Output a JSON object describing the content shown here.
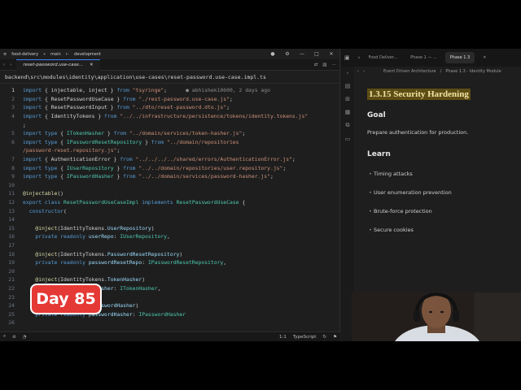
{
  "titlebar": {
    "project": "food-delivery",
    "branch": "main",
    "worktree": "development"
  },
  "editor": {
    "tab": "reset-password.use-case...",
    "path": "backend\\src\\modules\\identity\\application\\use-cases\\reset-password.use-case.impl.ts",
    "lines": [
      {
        "n": "1",
        "t": [
          [
            "kw",
            "import"
          ],
          [
            "lt",
            " { injectable, inject } "
          ],
          [
            "kw",
            "from"
          ],
          [
            "st",
            " \"tsyringe\""
          ],
          [
            "lt",
            ";      "
          ],
          [
            "blame",
            "● abhishek10600, 2 days ago"
          ]
        ]
      },
      {
        "n": "2",
        "t": [
          [
            "kw",
            "import"
          ],
          [
            "lt",
            " { ResetPasswordUseCase } "
          ],
          [
            "kw",
            "from"
          ],
          [
            "st",
            " \"./rest-password.use-case.js\""
          ],
          [
            "lt",
            ";"
          ]
        ]
      },
      {
        "n": "3",
        "t": [
          [
            "kw",
            "import"
          ],
          [
            "lt",
            " { ResetPasswordInput } "
          ],
          [
            "kw",
            "from"
          ],
          [
            "st",
            " \"../dto/reset-password.dto.js\""
          ],
          [
            "lt",
            ";"
          ]
        ]
      },
      {
        "n": "4",
        "t": [
          [
            "kw",
            "import"
          ],
          [
            "lt",
            " { IdentityTokens } "
          ],
          [
            "kw",
            "from"
          ],
          [
            "st",
            " \"../../infrastructure/persistence/tokens/identity.tokens.js\""
          ]
        ]
      },
      {
        "n": "",
        "t": [
          [
            "lt",
            ";"
          ]
        ]
      },
      {
        "n": "5",
        "t": [
          [
            "kw",
            "import type"
          ],
          [
            "lt",
            " { "
          ],
          [
            "ty",
            "ITokenHasher"
          ],
          [
            "lt",
            " } "
          ],
          [
            "kw",
            "from"
          ],
          [
            "st",
            " \"../domain/services/token-hasher.js\""
          ],
          [
            "lt",
            ";"
          ]
        ]
      },
      {
        "n": "6",
        "t": [
          [
            "kw",
            "import type"
          ],
          [
            "lt",
            " { "
          ],
          [
            "ty",
            "IPasswordResetRepository"
          ],
          [
            "lt",
            " } "
          ],
          [
            "kw",
            "from"
          ],
          [
            "st",
            " \"../domain/repositories"
          ]
        ]
      },
      {
        "n": "",
        "t": [
          [
            "st",
            "/password-reset.repository.js\""
          ],
          [
            "lt",
            ";"
          ]
        ]
      },
      {
        "n": "7",
        "t": [
          [
            "kw",
            "import"
          ],
          [
            "lt",
            " { AuthenticationError } "
          ],
          [
            "kw",
            "from"
          ],
          [
            "st",
            " \"../../../../shared/errors/AuthenticationError.js\""
          ],
          [
            "lt",
            ";"
          ]
        ]
      },
      {
        "n": "8",
        "t": [
          [
            "kw",
            "import type"
          ],
          [
            "lt",
            " { "
          ],
          [
            "ty",
            "IUserRepository"
          ],
          [
            "lt",
            " } "
          ],
          [
            "kw",
            "from"
          ],
          [
            "st",
            " \"../../domain/repositories/user.repository.js\""
          ],
          [
            "lt",
            ";"
          ]
        ]
      },
      {
        "n": "9",
        "t": [
          [
            "kw",
            "import type"
          ],
          [
            "lt",
            " { "
          ],
          [
            "ty",
            "IPasswordHasher"
          ],
          [
            "lt",
            " } "
          ],
          [
            "kw",
            "from"
          ],
          [
            "st",
            " \"../../domain/services/password-hasher.js\""
          ],
          [
            "lt",
            ";"
          ]
        ]
      },
      {
        "n": "10",
        "t": [
          [
            "lt",
            ""
          ]
        ]
      },
      {
        "n": "11",
        "t": [
          [
            "fn",
            "@injectable"
          ],
          [
            "lt",
            "()"
          ]
        ]
      },
      {
        "n": "12",
        "t": [
          [
            "kw",
            "export class"
          ],
          [
            "lt",
            " "
          ],
          [
            "ty",
            "ResetPasswordUseCaseImpl"
          ],
          [
            "lt",
            " "
          ],
          [
            "kw",
            "implements"
          ],
          [
            "lt",
            " "
          ],
          [
            "ty",
            "ResetPasswordUseCase"
          ],
          [
            "lt",
            " {"
          ]
        ]
      },
      {
        "n": "13",
        "t": [
          [
            "lt",
            "  "
          ],
          [
            "kw",
            "constructor"
          ],
          [
            "lt",
            "("
          ]
        ]
      },
      {
        "n": "14",
        "t": [
          [
            "lt",
            ""
          ]
        ]
      },
      {
        "n": "15",
        "t": [
          [
            "lt",
            "    "
          ],
          [
            "fn",
            "@inject"
          ],
          [
            "lt",
            "(IdentityTokens."
          ],
          [
            "vr",
            "UserRepository"
          ],
          [
            "lt",
            ")"
          ]
        ]
      },
      {
        "n": "16",
        "t": [
          [
            "lt",
            "    "
          ],
          [
            "kw",
            "private readonly"
          ],
          [
            "lt",
            " "
          ],
          [
            "vr",
            "userRepo"
          ],
          [
            "lt",
            ": "
          ],
          [
            "ty",
            "IUserRepository"
          ],
          [
            "lt",
            ","
          ]
        ]
      },
      {
        "n": "17",
        "t": [
          [
            "lt",
            ""
          ]
        ]
      },
      {
        "n": "18",
        "t": [
          [
            "lt",
            "    "
          ],
          [
            "fn",
            "@inject"
          ],
          [
            "lt",
            "(IdentityTokens."
          ],
          [
            "vr",
            "PasswordResetRepository"
          ],
          [
            "lt",
            ")"
          ]
        ]
      },
      {
        "n": "19",
        "t": [
          [
            "lt",
            "    "
          ],
          [
            "kw",
            "private readonly"
          ],
          [
            "lt",
            " "
          ],
          [
            "vr",
            "passwordResetRepo"
          ],
          [
            "lt",
            ": "
          ],
          [
            "ty",
            "IPasswordResetRepository"
          ],
          [
            "lt",
            ","
          ]
        ]
      },
      {
        "n": "20",
        "t": [
          [
            "lt",
            ""
          ]
        ]
      },
      {
        "n": "21",
        "t": [
          [
            "lt",
            "    "
          ],
          [
            "fn",
            "@inject"
          ],
          [
            "lt",
            "(IdentityTokens."
          ],
          [
            "vr",
            "TokenHasher"
          ],
          [
            "lt",
            ")"
          ]
        ]
      },
      {
        "n": "22",
        "t": [
          [
            "lt",
            "                  "
          ],
          [
            "vr",
            "tokenHasher"
          ],
          [
            "lt",
            ": "
          ],
          [
            "ty",
            "ITokenHasher"
          ],
          [
            "lt",
            ","
          ]
        ]
      },
      {
        "n": "23",
        "t": [
          [
            "lt",
            ""
          ]
        ]
      },
      {
        "n": "24",
        "t": [
          [
            "lt",
            "                  ens."
          ],
          [
            "vr",
            "PasswordHasher"
          ],
          [
            "lt",
            ")"
          ]
        ]
      },
      {
        "n": "25",
        "t": [
          [
            "lt",
            "    "
          ],
          [
            "kw",
            "private readonly"
          ],
          [
            "lt",
            " "
          ],
          [
            "vr",
            "passwordHasher"
          ],
          [
            "lt",
            ": "
          ],
          [
            "ty",
            "IPasswordHasher"
          ]
        ]
      },
      {
        "n": "26",
        "t": [
          [
            "lt",
            ""
          ]
        ]
      }
    ]
  },
  "status": {
    "position": "1:1",
    "language": "TypeScript"
  },
  "badge": "Day 85",
  "notes": {
    "tabs": [
      "Food Deliver...",
      "Phase 1 — ...",
      "Phase 1.3"
    ],
    "breadcrumb": [
      "Event Driven Architecture",
      "Phase 1.3 - Identity Module"
    ],
    "title": "1.3.15 Security Hardening",
    "goal_heading": "Goal",
    "goal_text": "Prepare authentication for production.",
    "learn_heading": "Learn",
    "learn_items": [
      "Timing attacks",
      "User enumeration prevention",
      "Brute-force protection",
      "Secure cookies"
    ]
  },
  "colors": {
    "badge_bg": "#e53935",
    "title_highlight": "#5c4d14",
    "accent": "#3b82f6"
  }
}
